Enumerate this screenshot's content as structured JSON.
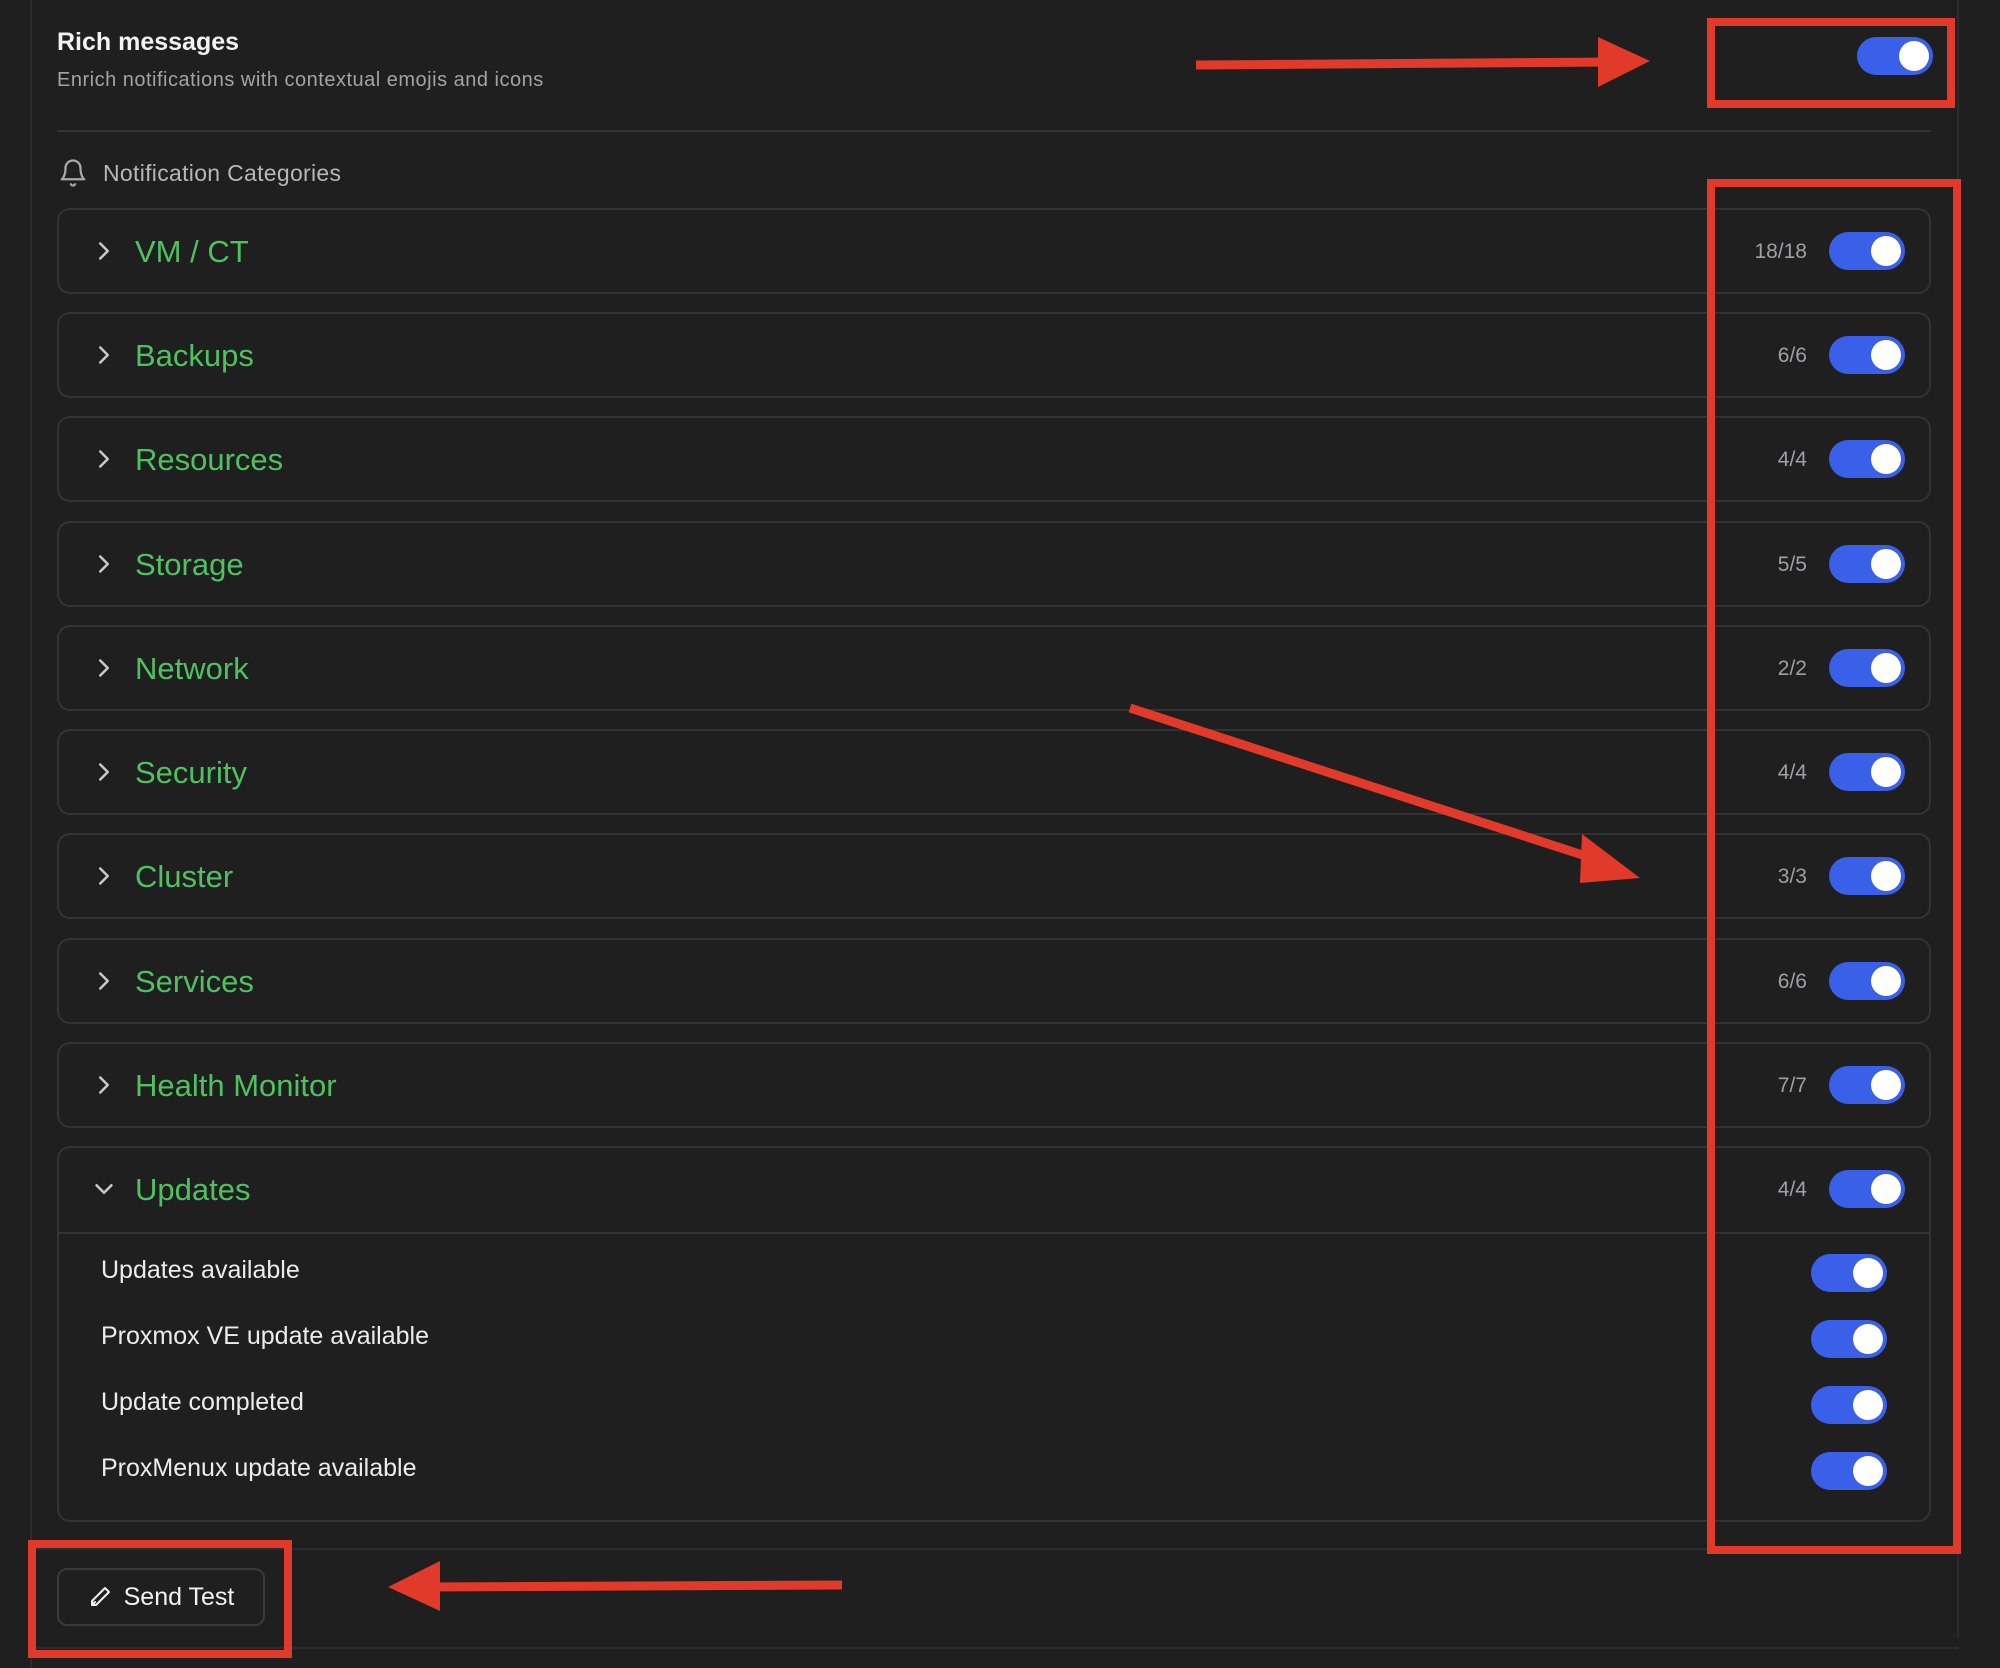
{
  "rich_messages": {
    "title": "Rich messages",
    "description": "Enrich notifications with contextual emojis and icons",
    "enabled": true
  },
  "section": {
    "title": "Notification Categories",
    "icon": "bell-icon"
  },
  "categories": [
    {
      "label": "VM / CT",
      "count": "18/18",
      "enabled": true,
      "expanded": false
    },
    {
      "label": "Backups",
      "count": "6/6",
      "enabled": true,
      "expanded": false
    },
    {
      "label": "Resources",
      "count": "4/4",
      "enabled": true,
      "expanded": false
    },
    {
      "label": "Storage",
      "count": "5/5",
      "enabled": true,
      "expanded": false
    },
    {
      "label": "Network",
      "count": "2/2",
      "enabled": true,
      "expanded": false
    },
    {
      "label": "Security",
      "count": "4/4",
      "enabled": true,
      "expanded": false
    },
    {
      "label": "Cluster",
      "count": "3/3",
      "enabled": true,
      "expanded": false
    },
    {
      "label": "Services",
      "count": "6/6",
      "enabled": true,
      "expanded": false
    },
    {
      "label": "Health Monitor",
      "count": "7/7",
      "enabled": true,
      "expanded": false
    },
    {
      "label": "Updates",
      "count": "4/4",
      "enabled": true,
      "expanded": true,
      "items": [
        {
          "label": "Updates available",
          "enabled": true
        },
        {
          "label": "Proxmox VE update available",
          "enabled": true
        },
        {
          "label": "Update completed",
          "enabled": true
        },
        {
          "label": "ProxMenux update available",
          "enabled": true
        }
      ]
    }
  ],
  "send_test": {
    "label": "Send Test",
    "icon": "pencil-icon"
  },
  "colors": {
    "background": "#1f1f20",
    "category_text": "#4fc15f",
    "toggle_on": "#3a5fe8",
    "annotation": "#e1392a"
  }
}
